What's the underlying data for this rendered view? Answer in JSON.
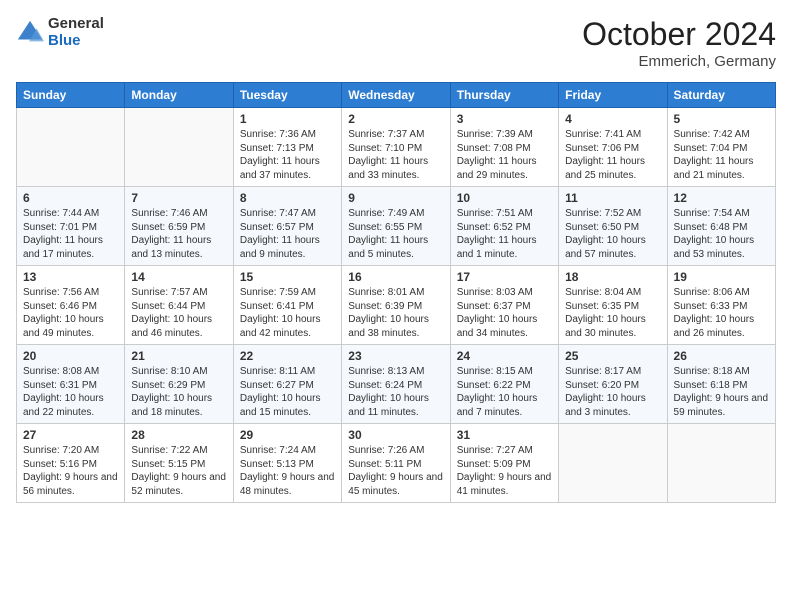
{
  "header": {
    "logo_general": "General",
    "logo_blue": "Blue",
    "month": "October 2024",
    "location": "Emmerich, Germany"
  },
  "weekdays": [
    "Sunday",
    "Monday",
    "Tuesday",
    "Wednesday",
    "Thursday",
    "Friday",
    "Saturday"
  ],
  "weeks": [
    [
      {
        "day": "",
        "content": ""
      },
      {
        "day": "",
        "content": ""
      },
      {
        "day": "1",
        "content": "Sunrise: 7:36 AM\nSunset: 7:13 PM\nDaylight: 11 hours and 37 minutes."
      },
      {
        "day": "2",
        "content": "Sunrise: 7:37 AM\nSunset: 7:10 PM\nDaylight: 11 hours and 33 minutes."
      },
      {
        "day": "3",
        "content": "Sunrise: 7:39 AM\nSunset: 7:08 PM\nDaylight: 11 hours and 29 minutes."
      },
      {
        "day": "4",
        "content": "Sunrise: 7:41 AM\nSunset: 7:06 PM\nDaylight: 11 hours and 25 minutes."
      },
      {
        "day": "5",
        "content": "Sunrise: 7:42 AM\nSunset: 7:04 PM\nDaylight: 11 hours and 21 minutes."
      }
    ],
    [
      {
        "day": "6",
        "content": "Sunrise: 7:44 AM\nSunset: 7:01 PM\nDaylight: 11 hours and 17 minutes."
      },
      {
        "day": "7",
        "content": "Sunrise: 7:46 AM\nSunset: 6:59 PM\nDaylight: 11 hours and 13 minutes."
      },
      {
        "day": "8",
        "content": "Sunrise: 7:47 AM\nSunset: 6:57 PM\nDaylight: 11 hours and 9 minutes."
      },
      {
        "day": "9",
        "content": "Sunrise: 7:49 AM\nSunset: 6:55 PM\nDaylight: 11 hours and 5 minutes."
      },
      {
        "day": "10",
        "content": "Sunrise: 7:51 AM\nSunset: 6:52 PM\nDaylight: 11 hours and 1 minute."
      },
      {
        "day": "11",
        "content": "Sunrise: 7:52 AM\nSunset: 6:50 PM\nDaylight: 10 hours and 57 minutes."
      },
      {
        "day": "12",
        "content": "Sunrise: 7:54 AM\nSunset: 6:48 PM\nDaylight: 10 hours and 53 minutes."
      }
    ],
    [
      {
        "day": "13",
        "content": "Sunrise: 7:56 AM\nSunset: 6:46 PM\nDaylight: 10 hours and 49 minutes."
      },
      {
        "day": "14",
        "content": "Sunrise: 7:57 AM\nSunset: 6:44 PM\nDaylight: 10 hours and 46 minutes."
      },
      {
        "day": "15",
        "content": "Sunrise: 7:59 AM\nSunset: 6:41 PM\nDaylight: 10 hours and 42 minutes."
      },
      {
        "day": "16",
        "content": "Sunrise: 8:01 AM\nSunset: 6:39 PM\nDaylight: 10 hours and 38 minutes."
      },
      {
        "day": "17",
        "content": "Sunrise: 8:03 AM\nSunset: 6:37 PM\nDaylight: 10 hours and 34 minutes."
      },
      {
        "day": "18",
        "content": "Sunrise: 8:04 AM\nSunset: 6:35 PM\nDaylight: 10 hours and 30 minutes."
      },
      {
        "day": "19",
        "content": "Sunrise: 8:06 AM\nSunset: 6:33 PM\nDaylight: 10 hours and 26 minutes."
      }
    ],
    [
      {
        "day": "20",
        "content": "Sunrise: 8:08 AM\nSunset: 6:31 PM\nDaylight: 10 hours and 22 minutes."
      },
      {
        "day": "21",
        "content": "Sunrise: 8:10 AM\nSunset: 6:29 PM\nDaylight: 10 hours and 18 minutes."
      },
      {
        "day": "22",
        "content": "Sunrise: 8:11 AM\nSunset: 6:27 PM\nDaylight: 10 hours and 15 minutes."
      },
      {
        "day": "23",
        "content": "Sunrise: 8:13 AM\nSunset: 6:24 PM\nDaylight: 10 hours and 11 minutes."
      },
      {
        "day": "24",
        "content": "Sunrise: 8:15 AM\nSunset: 6:22 PM\nDaylight: 10 hours and 7 minutes."
      },
      {
        "day": "25",
        "content": "Sunrise: 8:17 AM\nSunset: 6:20 PM\nDaylight: 10 hours and 3 minutes."
      },
      {
        "day": "26",
        "content": "Sunrise: 8:18 AM\nSunset: 6:18 PM\nDaylight: 9 hours and 59 minutes."
      }
    ],
    [
      {
        "day": "27",
        "content": "Sunrise: 7:20 AM\nSunset: 5:16 PM\nDaylight: 9 hours and 56 minutes."
      },
      {
        "day": "28",
        "content": "Sunrise: 7:22 AM\nSunset: 5:15 PM\nDaylight: 9 hours and 52 minutes."
      },
      {
        "day": "29",
        "content": "Sunrise: 7:24 AM\nSunset: 5:13 PM\nDaylight: 9 hours and 48 minutes."
      },
      {
        "day": "30",
        "content": "Sunrise: 7:26 AM\nSunset: 5:11 PM\nDaylight: 9 hours and 45 minutes."
      },
      {
        "day": "31",
        "content": "Sunrise: 7:27 AM\nSunset: 5:09 PM\nDaylight: 9 hours and 41 minutes."
      },
      {
        "day": "",
        "content": ""
      },
      {
        "day": "",
        "content": ""
      }
    ]
  ]
}
